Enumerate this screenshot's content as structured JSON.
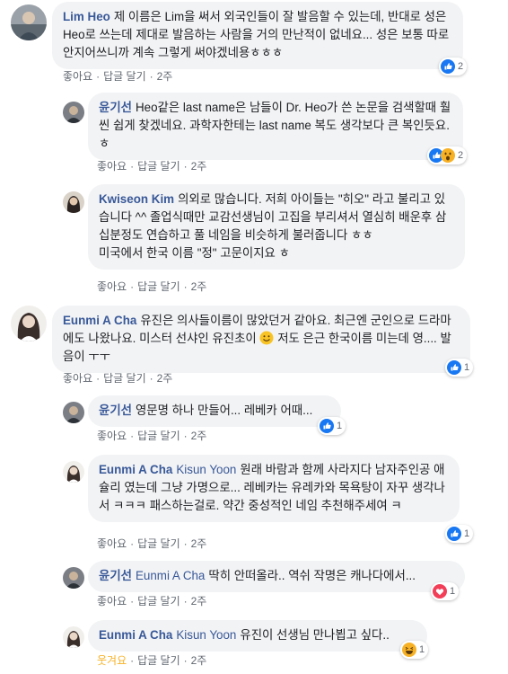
{
  "comments": [
    {
      "author": "Lim Heo",
      "text": "제 이름은 Lim을 써서 외국인들이 잘 발음할 수 있는데, 반대로 성은 Heo로 쓰는데 제대로 발음하는 사람을 거의 만난적이 없네요... 성은 보통 따로 안지어쓰니까 계속 그렇게 써야겠네용ㅎㅎㅎ",
      "like": "좋아요",
      "reply": "답글 달기",
      "time": "2주",
      "reaction_count": "2"
    },
    {
      "author": "윤기선",
      "text": "Heo같은 last name은 남들이 Dr. Heo가 쓴 논문을 검색할때 훨씬 쉽게 찾겠네요. 과학자한테는 last name 복도 생각보다 큰 복인듯요. ㅎ",
      "like": "좋아요",
      "reply": "답글 달기",
      "time": "2주",
      "reaction_count": "2"
    },
    {
      "author": "Kwiseon Kim",
      "text": "의외로 많습니다. 저희 아이들는 \"히오\" 라고 불리고 있습니다 ^^ 졸업식때만 교감선생님이 고집을 부리셔서 열심히 배운후 삼십분정도 연습하고 풀 네임을 비슷하게 불러줍니다 ㅎㅎ",
      "text2": "미국에서 한국 이름 \"정\" 고문이지요 ㅎ",
      "like": "좋아요",
      "reply": "답글 달기",
      "time": "2주"
    },
    {
      "author": "Eunmi A Cha",
      "text_a": "유진은 의사들이름이 많았던거 같아요. 최근엔 군인으로 드라마에도 나왔나요. 미스터 선샤인 유진초이",
      "text_b": "저도 은근 한국이름 미는데 영.... 발음이 ㅜㅜ",
      "like": "좋아요",
      "reply": "답글 달기",
      "time": "2주",
      "reaction_count": "1"
    },
    {
      "author": "윤기선",
      "text": "영문명 하나 만들어... 레베카 어때...",
      "like": "좋아요",
      "reply": "답글 달기",
      "time": "2주",
      "reaction_count": "1"
    },
    {
      "author": "Eunmi A Cha",
      "tag": "Kisun Yoon",
      "text": "원래 바람과 함께 사라지다 남자주인공 애슐리 였는데 그냥 가명으로... 레베카는 유레카와 목욕탕이 자꾸 생각나서 ㅋㅋㅋ 패스하는걸로. 약간 중성적인 네임 추천해주세여 ㅋ",
      "like": "좋아요",
      "reply": "답글 달기",
      "time": "2주",
      "reaction_count": "1"
    },
    {
      "author": "윤기선",
      "tag": "Eunmi A Cha",
      "text": "딱히 안떠올라.. 역쉬 작명은 캐나다에서...",
      "like": "좋아요",
      "reply": "답글 달기",
      "time": "2주",
      "reaction_count": "1"
    },
    {
      "author": "Eunmi A Cha",
      "tag": "Kisun Yoon",
      "text": "유진이 선생님 만나뵙고 싶다..",
      "like": "웃겨요",
      "reply": "답글 달기",
      "time": "2주",
      "reaction_count": "1"
    }
  ],
  "colors": {
    "name": "#385898",
    "bubble": "#f2f3f5",
    "meta": "#606770",
    "like_blue": "#1877f2",
    "love_red": "#f33e58",
    "haha_yellow": "#f7b125"
  },
  "icons": [
    "like-icon",
    "wow-icon",
    "love-icon",
    "haha-icon",
    "smile-emoji-icon"
  ]
}
